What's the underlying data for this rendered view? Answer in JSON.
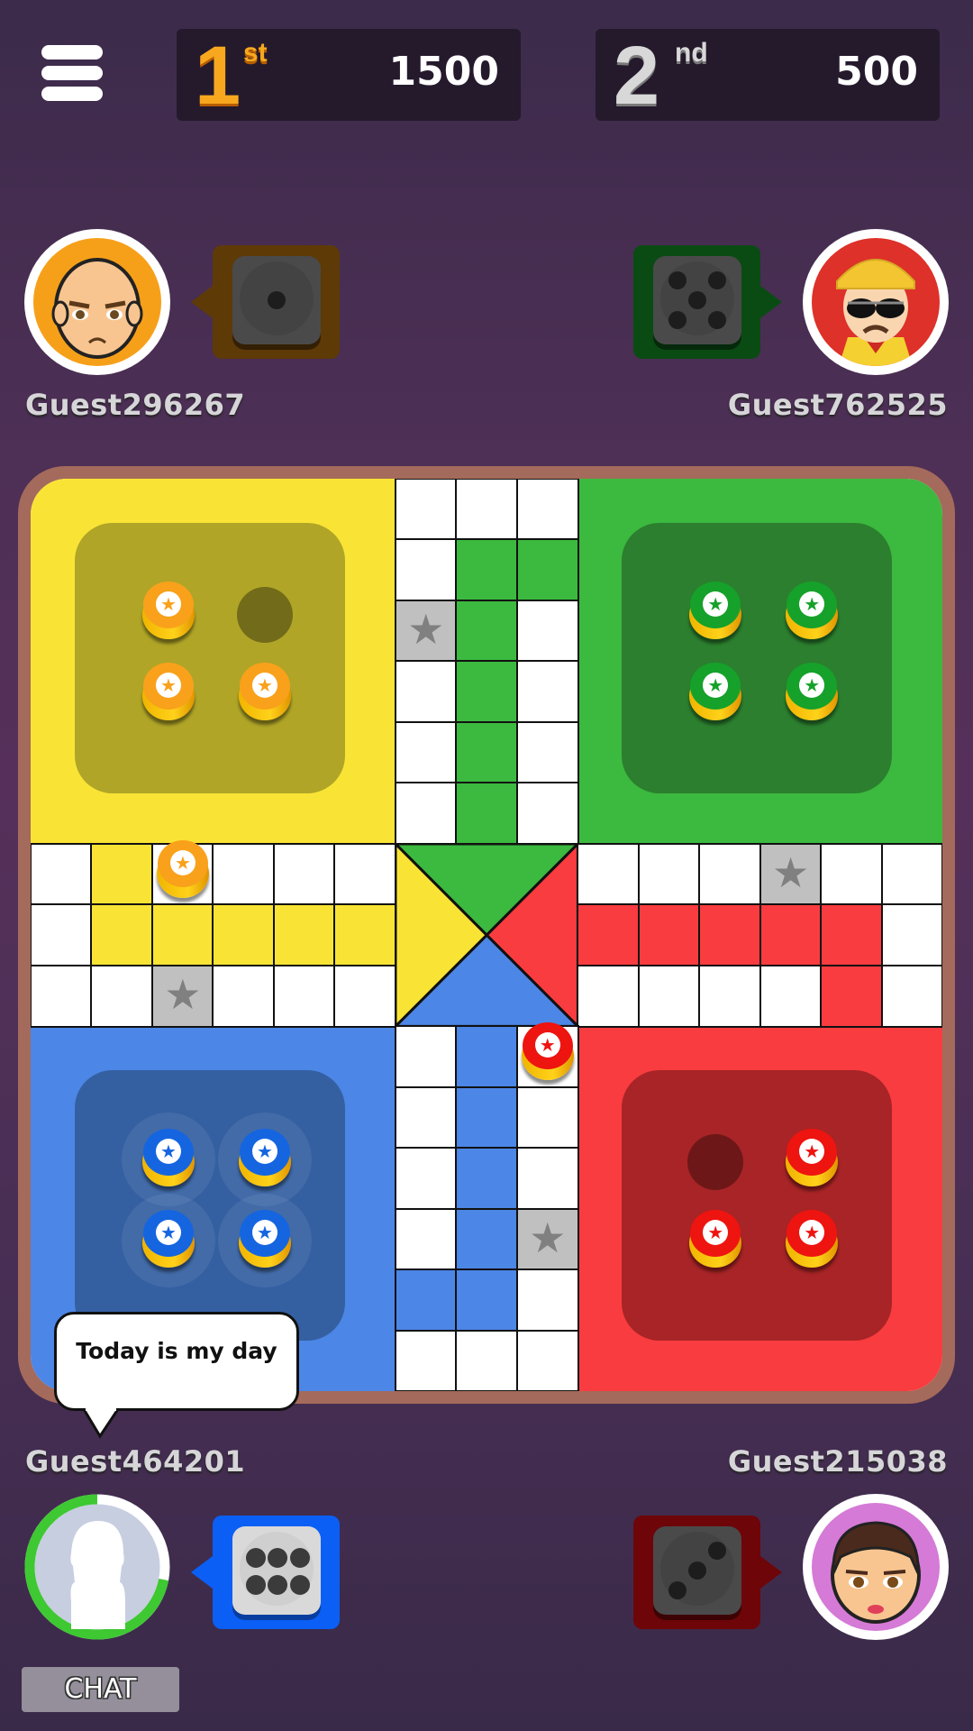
{
  "colors": {
    "yellow": "#f9e435",
    "yellow_home": "#b0a527",
    "yellow_token": "#f9a11b",
    "green": "#3cb93f",
    "green_home": "#2b7f2e",
    "green_token": "#16a12a",
    "red": "#f93c3f",
    "red_home": "#a82426",
    "red_token": "#ee1410",
    "blue": "#4c86e6",
    "blue_home": "#3460a2",
    "blue_token": "#1565e0",
    "safe_cell": "#c0c0c0",
    "star": "#808080",
    "yellow_dice_bg": "#5e3a07",
    "green_dice_bg": "#0a4b14",
    "blue_dice_bg": "#0b5ff5",
    "red_dice_bg": "#6e0508",
    "timer_ring": "#3ec832"
  },
  "menu": {
    "icon": "hamburger-menu-icon"
  },
  "leaderboard": [
    {
      "rank": "1",
      "suffix": "st",
      "score": "1500"
    },
    {
      "rank": "2",
      "suffix": "nd",
      "score": "500"
    }
  ],
  "players": {
    "yellow": {
      "name": "Guest296267",
      "avatar": "bald-man-avatar",
      "dice_value": 1
    },
    "green": {
      "name": "Guest762525",
      "avatar": "construction-worker-avatar",
      "dice_value": 5
    },
    "blue": {
      "name": "Guest464201",
      "avatar": "default-silhouette-avatar",
      "dice_value": 6,
      "active_turn": true,
      "timer_remaining": 0.72
    },
    "red": {
      "name": "Guest215038",
      "avatar": "woman-avatar",
      "dice_value": 3
    }
  },
  "chat_bubble": {
    "text": "Today is my day",
    "from": "Guest464201"
  },
  "chat_button": {
    "label": "CHAT"
  },
  "board": {
    "safe_star_cells": [
      [
        2,
        6
      ],
      [
        8,
        2
      ],
      [
        12,
        8
      ],
      [
        6,
        12
      ]
    ],
    "home_columns": {
      "green": [
        [
          1,
          7
        ],
        [
          2,
          7
        ],
        [
          3,
          7
        ],
        [
          4,
          7
        ],
        [
          5,
          7
        ],
        [
          1,
          8
        ]
      ],
      "yellow": [
        [
          7,
          1
        ],
        [
          7,
          2
        ],
        [
          7,
          3
        ],
        [
          7,
          4
        ],
        [
          7,
          5
        ],
        [
          6,
          1
        ]
      ],
      "red": [
        [
          7,
          9
        ],
        [
          7,
          10
        ],
        [
          7,
          11
        ],
        [
          7,
          12
        ],
        [
          7,
          13
        ],
        [
          8,
          13
        ]
      ],
      "blue": [
        [
          9,
          7
        ],
        [
          10,
          7
        ],
        [
          11,
          7
        ],
        [
          12,
          7
        ],
        [
          13,
          7
        ],
        [
          13,
          6
        ]
      ]
    },
    "tokens_in_home": {
      "yellow": [
        0,
        2,
        3
      ],
      "green": [
        0,
        1,
        2,
        3
      ],
      "blue": [
        0,
        1,
        2,
        3
      ],
      "red": [
        1,
        2,
        3
      ]
    },
    "tokens_on_track": [
      {
        "color": "yellow",
        "row": 6,
        "col": 2
      },
      {
        "color": "red",
        "row": 9,
        "col": 8
      }
    ],
    "star_glyph": "★"
  }
}
